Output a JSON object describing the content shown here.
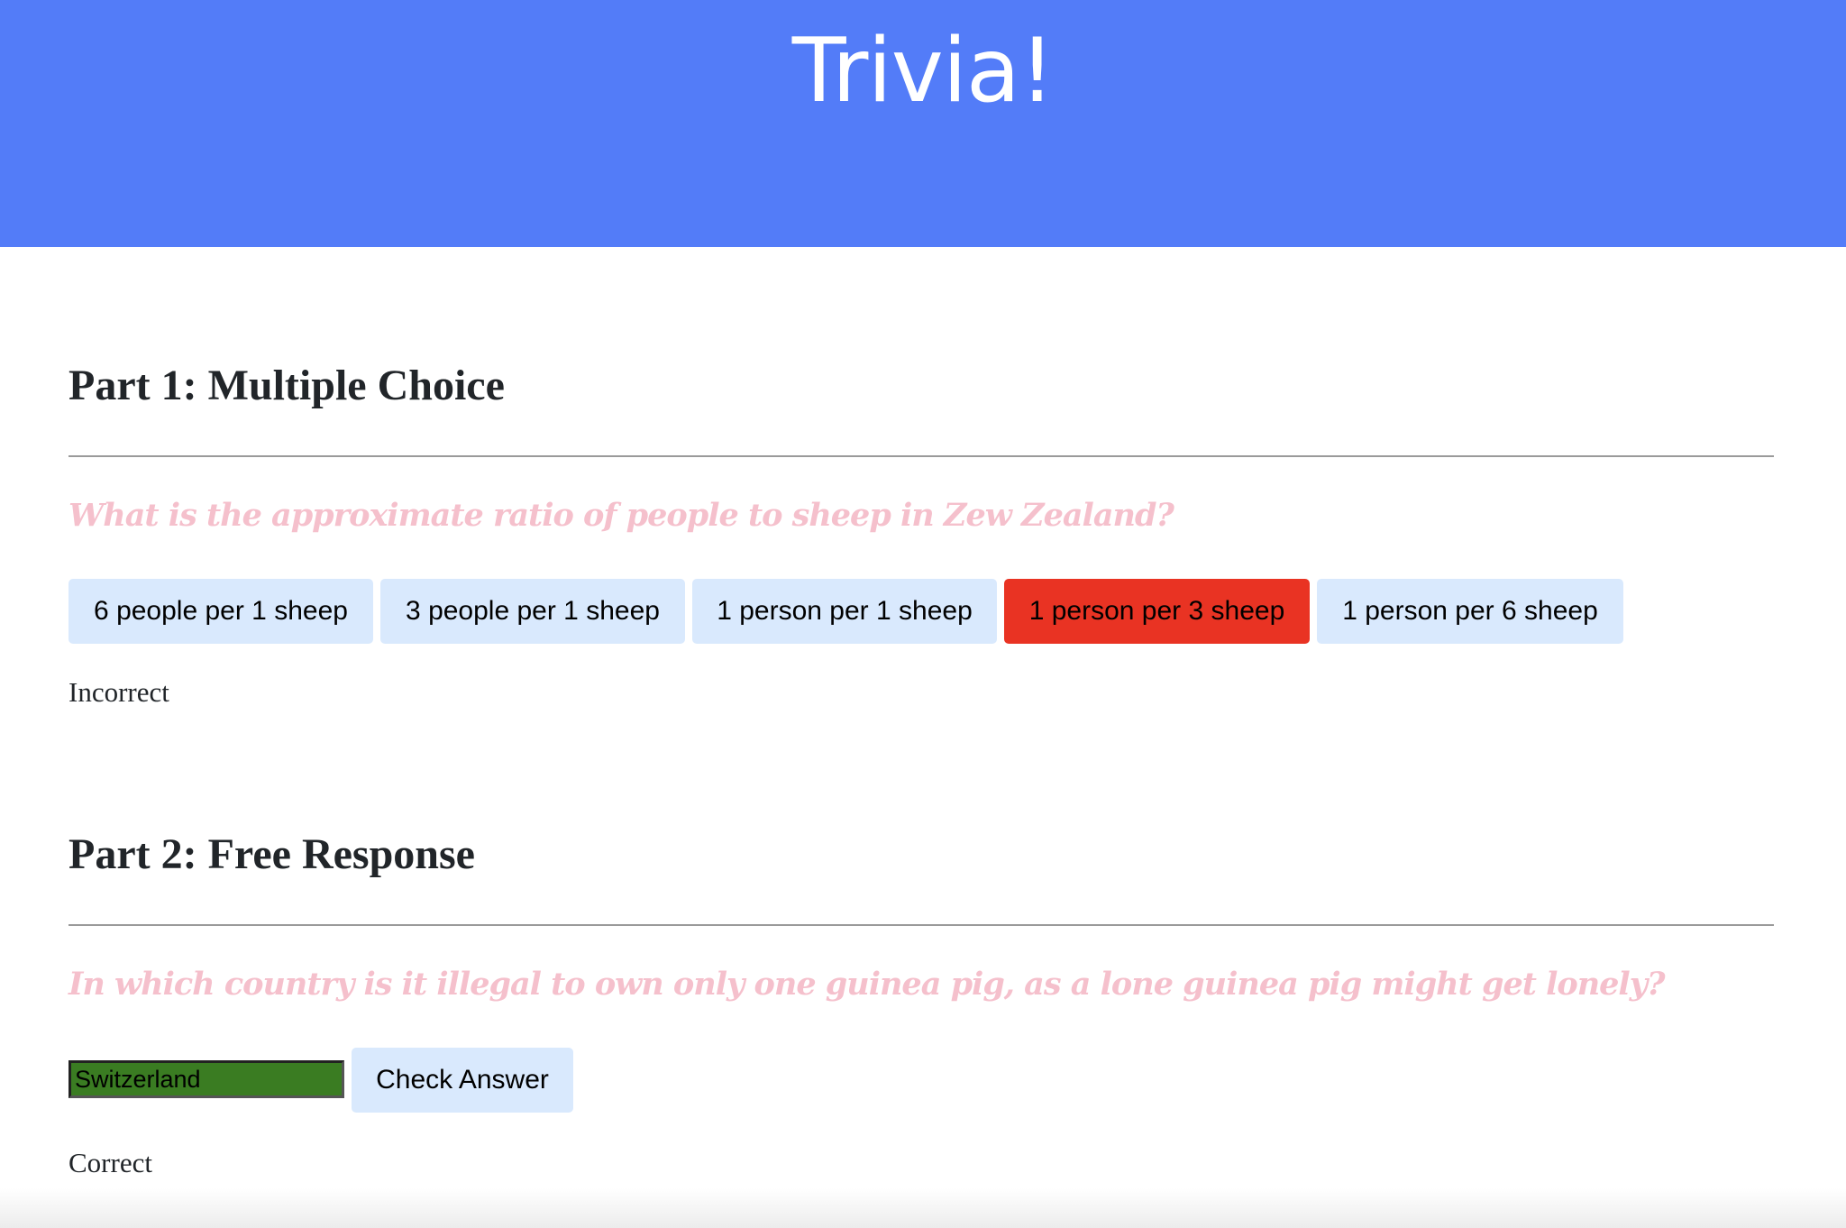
{
  "header": {
    "title": "Trivia!"
  },
  "part1": {
    "title": "Part 1: Multiple Choice",
    "question": "What is the approximate ratio of people to sheep in Zew Zealand?",
    "choices": [
      {
        "label": "6 people per 1 sheep",
        "state": "default"
      },
      {
        "label": "3 people per 1 sheep",
        "state": "default"
      },
      {
        "label": "1 person per 1 sheep",
        "state": "default"
      },
      {
        "label": "1 person per 3 sheep",
        "state": "incorrect"
      },
      {
        "label": "1 person per 6 sheep",
        "state": "default"
      }
    ],
    "feedback": "Incorrect"
  },
  "part2": {
    "title": "Part 2: Free Response",
    "question": "In which country is it illegal to own only one guinea pig, as a lone guinea pig might get lonely?",
    "input_value": "Switzerland",
    "check_label": "Check Answer",
    "feedback": "Correct"
  },
  "colors": {
    "header_bg": "#537cf8",
    "button_bg": "#d9e9fd",
    "incorrect_bg": "#e93323",
    "correct_input_bg": "#3a7c22",
    "question_text": "#f5c0cc"
  }
}
